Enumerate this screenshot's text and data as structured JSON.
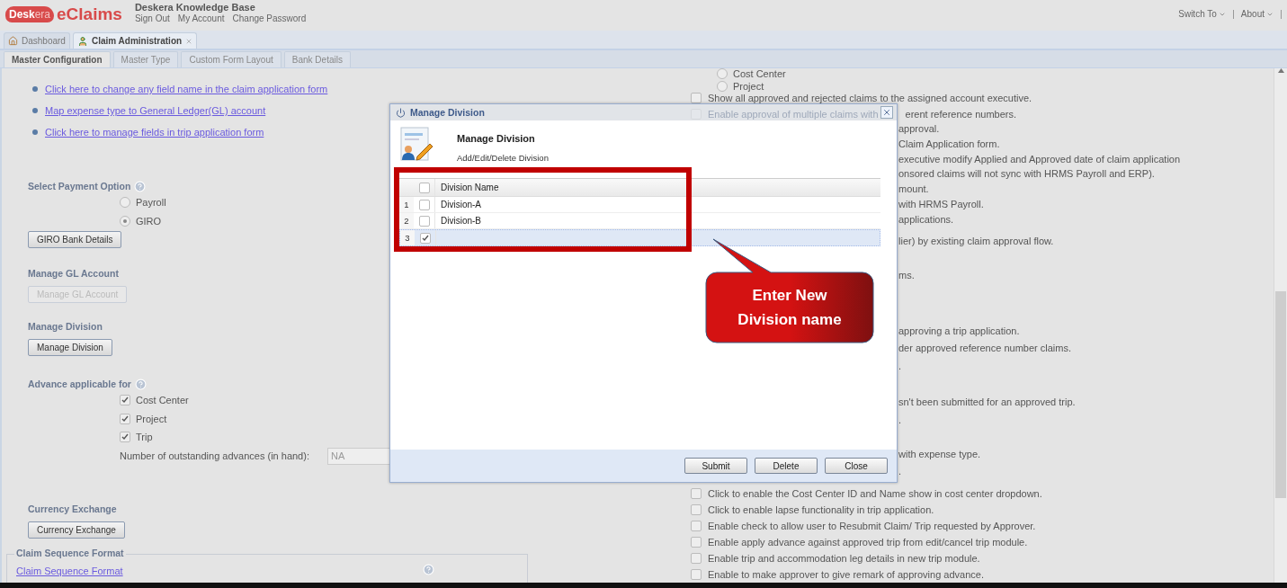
{
  "header": {
    "logo": {
      "mark_left": "Desk",
      "mark_right": "era",
      "product": "eClaims"
    },
    "company": "Deskera Knowledge Base",
    "user_links": [
      "Sign Out",
      "My Account",
      "Change Password"
    ],
    "menus": [
      "Switch To",
      "About"
    ]
  },
  "main_tabs": [
    {
      "label": "Dashboard",
      "selected": false,
      "closable": false
    },
    {
      "label": "Claim Administration",
      "selected": true,
      "closable": true
    }
  ],
  "sub_tabs": [
    {
      "label": "Master Configuration",
      "selected": true
    },
    {
      "label": "Master Type",
      "selected": false
    },
    {
      "label": "Custom Form Layout",
      "selected": false
    },
    {
      "label": "Bank Details",
      "selected": false
    }
  ],
  "links": [
    "Click here to change any field name in the claim application form",
    "Map expense type to General Ledger(GL) account",
    "Click here to manage fields in trip application form"
  ],
  "payment": {
    "title": "Select Payment Option",
    "options": [
      {
        "label": "Payroll",
        "selected": false
      },
      {
        "label": "GIRO",
        "selected": true
      }
    ],
    "button": {
      "label": "GIRO Bank Details",
      "disabled": false
    }
  },
  "gl": {
    "title": "Manage GL Account",
    "button": {
      "label": "Manage GL Account",
      "disabled": true
    }
  },
  "division": {
    "title": "Manage Division",
    "button": {
      "label": "Manage Division",
      "disabled": false
    }
  },
  "advance": {
    "title": "Advance applicable for",
    "options": [
      {
        "label": "Cost Center",
        "checked": true
      },
      {
        "label": "Project",
        "checked": true
      },
      {
        "label": "Trip",
        "checked": true
      }
    ],
    "outstanding": {
      "label": "Number of outstanding advances (in hand):",
      "value": "NA"
    }
  },
  "currency": {
    "title": "Currency Exchange",
    "button": {
      "label": "Currency Exchange",
      "disabled": false
    }
  },
  "sequence": {
    "legend": "Claim Sequence Format",
    "link": "Claim Sequence Format"
  },
  "settings": [
    {
      "kind": "radio",
      "label": "Cost Center",
      "selected": false
    },
    {
      "kind": "radio",
      "label": "Project",
      "selected": false
    },
    {
      "kind": "check",
      "label": "Show all approved and rejected claims to the assigned account executive.",
      "checked": false
    },
    {
      "kind": "split",
      "label": "Enable approval of multiple claims with",
      "tail": "erent reference numbers.",
      "checked": false
    },
    {
      "kind": "fragment",
      "label": "approval."
    },
    {
      "kind": "fragment",
      "label": "Claim Application form."
    },
    {
      "kind": "fragment",
      "label": "executive modify Applied and Approved date of claim application"
    },
    {
      "kind": "fragment",
      "label": "onsored claims will not sync with HRMS Payroll and ERP)."
    },
    {
      "kind": "fragment",
      "label": "mount."
    },
    {
      "kind": "fragment",
      "label": "with HRMS Payroll."
    },
    {
      "kind": "fragment",
      "label": "applications."
    },
    {
      "kind": "fragment",
      "label": "lier) by existing claim approval flow."
    },
    {
      "kind": "fragment",
      "label": "ms."
    },
    {
      "kind": "fragment",
      "label": "approving a trip application."
    },
    {
      "kind": "fragment",
      "label": "der approved reference number claims."
    },
    {
      "kind": "fragment",
      "label": "."
    },
    {
      "kind": "fragment",
      "label": "sn't been submitted for an approved trip."
    },
    {
      "kind": "fragment",
      "label": "."
    },
    {
      "kind": "fragment",
      "label": "with expense type."
    },
    {
      "kind": "fragment",
      "label": "."
    },
    {
      "kind": "check",
      "label": "Click to enable the Cost Center ID and Name show in cost center dropdown.",
      "checked": false
    },
    {
      "kind": "check",
      "label": "Click to enable lapse functionality in trip application.",
      "checked": false
    },
    {
      "kind": "check",
      "label": "Enable check to allow user to Resubmit Claim/ Trip requested by Approver.",
      "checked": false
    },
    {
      "kind": "check",
      "label": "Enable apply advance against approved trip from edit/cancel trip module.",
      "checked": false
    },
    {
      "kind": "check",
      "label": "Enable trip and accommodation leg details in new trip module.",
      "checked": false
    },
    {
      "kind": "check",
      "label": "Enable to make approver to give remark of approving advance.",
      "checked": false
    }
  ],
  "dialog": {
    "title": "Manage Division",
    "heading": "Manage Division",
    "subtitle": "Add/Edit/Delete Division",
    "grid": {
      "column": "Division Name",
      "all_checked": false,
      "rows": [
        {
          "number": "1",
          "checked": false,
          "selected": false,
          "name": "Division-A"
        },
        {
          "number": "2",
          "checked": false,
          "selected": false,
          "name": "Division-B"
        },
        {
          "number": "3",
          "checked": true,
          "selected": true
        }
      ]
    },
    "buttons": [
      "Submit",
      "Delete",
      "Close"
    ]
  },
  "callout": {
    "text": "Enter New Division name"
  }
}
